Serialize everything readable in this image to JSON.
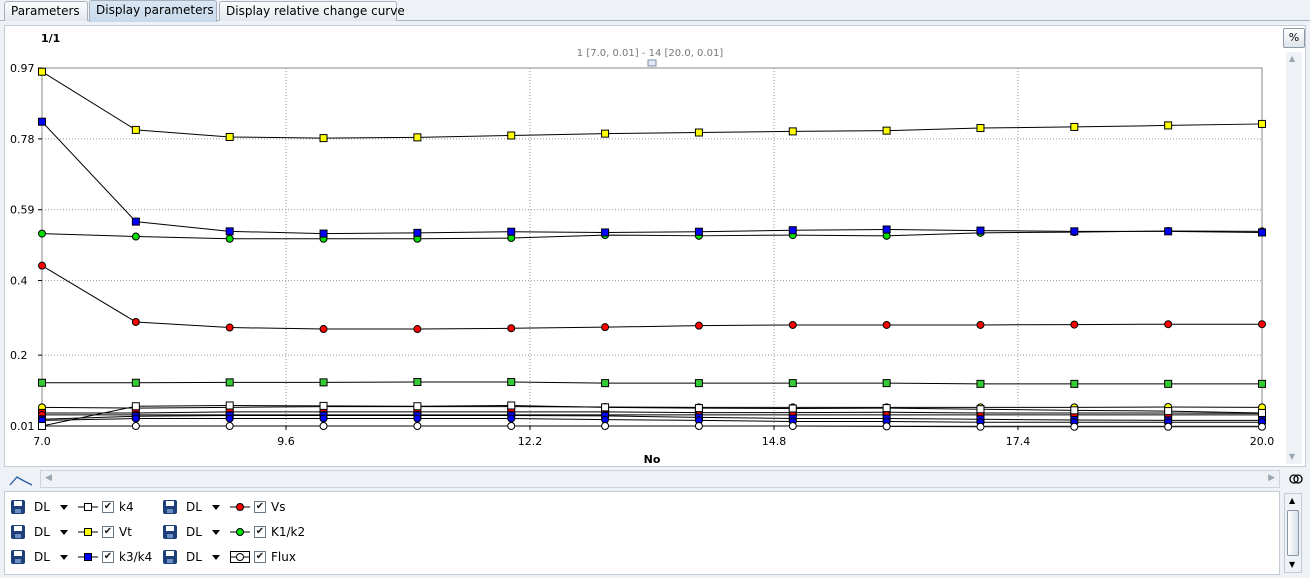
{
  "tabs": [
    {
      "label": "Parameters",
      "active": false
    },
    {
      "label": "Display parameters",
      "active": true
    },
    {
      "label": "Display relative change curve",
      "active": false
    }
  ],
  "chart": {
    "page_indicator": "1/1",
    "range_label": "1 [7.0, 0.01] - 14 [20.0, 0.01]",
    "percent_button": "%"
  },
  "chart_data": {
    "type": "line",
    "xlabel": "No",
    "ylabel": "",
    "xlim": [
      7.0,
      20.0
    ],
    "ylim": [
      0.01,
      0.97
    ],
    "x_ticks": [
      7.0,
      9.6,
      12.2,
      14.8,
      17.4,
      20.0
    ],
    "x_tick_labels": [
      "7.0",
      "9.6",
      "12.2",
      "14.8",
      "17.4",
      "20.0"
    ],
    "y_ticks": [
      0.01,
      0.2,
      0.4,
      0.59,
      0.78,
      0.97
    ],
    "y_tick_labels": [
      "0.01",
      "0.2",
      "0.4",
      "0.59",
      "0.78",
      "0.97"
    ],
    "grid": true,
    "x": [
      7,
      8,
      9,
      10,
      11,
      12,
      13,
      14,
      15,
      16,
      17,
      18,
      19,
      20
    ],
    "series": [
      {
        "name": "Vt",
        "color": "#ffff00",
        "marker": "square",
        "values": [
          0.96,
          0.804,
          0.785,
          0.782,
          0.784,
          0.789,
          0.794,
          0.797,
          0.8,
          0.802,
          0.809,
          0.812,
          0.816,
          0.82
        ]
      },
      {
        "name": "k3/k4",
        "color": "#0000ff",
        "marker": "square",
        "values": [
          0.826,
          0.558,
          0.532,
          0.526,
          0.528,
          0.531,
          0.529,
          0.531,
          0.535,
          0.537,
          0.534,
          0.532,
          0.532,
          0.529
        ]
      },
      {
        "name": "K1/k2",
        "color": "#00dd00",
        "marker": "circle",
        "values": [
          0.526,
          0.518,
          0.512,
          0.512,
          0.512,
          0.514,
          0.522,
          0.52,
          0.522,
          0.52,
          0.528,
          0.53,
          0.533,
          0.532
        ]
      },
      {
        "name": "Vs",
        "color": "#ff0000",
        "marker": "circle",
        "values": [
          0.44,
          0.289,
          0.274,
          0.27,
          0.27,
          0.272,
          0.275,
          0.279,
          0.281,
          0.281,
          0.281,
          0.282,
          0.283,
          0.283
        ]
      },
      {
        "name": "k4",
        "color": "#ffffff",
        "marker": "square",
        "values": [
          0.01,
          0.063,
          0.065,
          0.064,
          0.063,
          0.065,
          0.06,
          0.058,
          0.057,
          0.058,
          0.055,
          0.052,
          0.05,
          0.045
        ]
      },
      {
        "name": "Flux",
        "color": "#ffffff",
        "marker": "circle",
        "values": [
          0.01,
          0.01,
          0.01,
          0.01,
          0.01,
          0.01,
          0.01,
          0.01,
          0.01,
          0.009,
          0.008,
          0.008,
          0.008,
          0.008
        ]
      }
    ],
    "extra_series": [
      {
        "color": "#33cc33",
        "marker": "square",
        "values": [
          0.126,
          0.126,
          0.127,
          0.127,
          0.128,
          0.128,
          0.125,
          0.125,
          0.125,
          0.125,
          0.123,
          0.123,
          0.123,
          0.123
        ]
      },
      {
        "color": "#ffff00",
        "marker": "circle",
        "values": [
          0.06,
          0.058,
          0.06,
          0.062,
          0.062,
          0.062,
          0.061,
          0.06,
          0.06,
          0.06,
          0.06,
          0.06,
          0.061,
          0.06
        ]
      },
      {
        "color": "#ff0000",
        "marker": "square",
        "values": [
          0.045,
          0.045,
          0.048,
          0.048,
          0.048,
          0.048,
          0.048,
          0.046,
          0.046,
          0.047,
          0.045,
          0.045,
          0.045,
          0.044
        ]
      },
      {
        "color": "#ff0000",
        "marker": "circle",
        "values": [
          0.04,
          0.04,
          0.04,
          0.04,
          0.04,
          0.04,
          0.04,
          0.04,
          0.04,
          0.04,
          0.04,
          0.04,
          0.04,
          0.04
        ]
      },
      {
        "color": "#0000ff",
        "marker": "square",
        "values": [
          0.028,
          0.036,
          0.038,
          0.038,
          0.038,
          0.038,
          0.037,
          0.033,
          0.03,
          0.03,
          0.028,
          0.026,
          0.025,
          0.025
        ]
      },
      {
        "color": "#0000ff",
        "marker": "circle",
        "values": [
          0.025,
          0.03,
          0.03,
          0.03,
          0.03,
          0.03,
          0.027,
          0.025,
          0.022,
          0.022,
          0.02,
          0.02,
          0.02,
          0.02
        ]
      }
    ]
  },
  "legend": {
    "rows": [
      [
        {
          "dl": "DL",
          "label": "k4",
          "style": "line-square",
          "color": "#ffffff"
        },
        {
          "dl": "DL",
          "label": "Vs",
          "style": "line-circle",
          "color": "#ff0000"
        }
      ],
      [
        {
          "dl": "DL",
          "label": "Vt",
          "style": "line-square",
          "color": "#ffff00"
        },
        {
          "dl": "DL",
          "label": "K1/k2",
          "style": "line-circle",
          "color": "#00dd00"
        }
      ],
      [
        {
          "dl": "DL",
          "label": "k3/k4",
          "style": "line-square",
          "color": "#0000ff"
        },
        {
          "dl": "DL",
          "label": "Flux",
          "style": "line-circle-boxed",
          "color": "#ffffff"
        }
      ]
    ]
  },
  "icons": {
    "curve_tool": "curve-icon",
    "up": "triangle-up-icon",
    "close": "close-icon",
    "link": "link-icon"
  }
}
